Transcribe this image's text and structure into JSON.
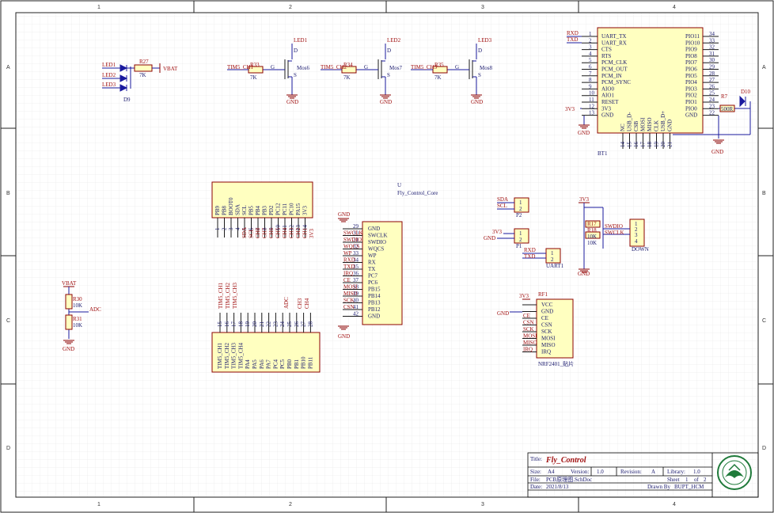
{
  "zones": {
    "cols": [
      "1",
      "2",
      "3",
      "4"
    ],
    "rows": [
      "A",
      "B",
      "C",
      "D"
    ]
  },
  "title_block": {
    "title_label": "Title:",
    "title": "Fly_Control",
    "size_label": "Size:",
    "size": "A4",
    "version_label": "Version:",
    "version": "1.0",
    "revision_label": "Revision:",
    "revision": "A",
    "library_label": "Library:",
    "library": "1.0",
    "file_label": "File:",
    "file": "PCB原理图.SchDoc",
    "sheet_label": "Sheet",
    "sheet": "1",
    "sheet_of": "of",
    "sheet_total": "2",
    "date_label": "Date:",
    "date": "2021/8/13",
    "drawn_label": "Drawn By",
    "drawn_by": "BUPT_HCM"
  },
  "leds_group": {
    "net_led1": "LED1",
    "net_led2": "LED2",
    "net_led3": "LED3",
    "r_ref": "R27",
    "r_val": "7K",
    "power": "VBAT",
    "diode_ref": "D9"
  },
  "mosfets": [
    {
      "led": "LED1",
      "ref": "Mos6",
      "r_ref": "R33",
      "r_val": "7K",
      "tim": "TIM5_CH1",
      "gnd": "GND",
      "g": "G",
      "d": "D",
      "s": "S"
    },
    {
      "led": "LED2",
      "ref": "Mos7",
      "r_ref": "R34",
      "r_val": "7K",
      "tim": "TIM5_CH2",
      "gnd": "GND",
      "g": "G",
      "d": "D",
      "s": "S"
    },
    {
      "led": "LED3",
      "ref": "Mos8",
      "r_ref": "R35",
      "r_val": "7K",
      "tim": "TIM5_CH3",
      "gnd": "GND",
      "g": "G",
      "d": "D",
      "s": "S"
    }
  ],
  "bt": {
    "ref": "BT1",
    "net_rxd": "RXD",
    "net_txd": "TXD",
    "net_3v3": "3V3",
    "gnd": "GND",
    "left_pins": [
      {
        "n": "1",
        "name": "UART_TX"
      },
      {
        "n": "2",
        "name": "UART_RX"
      },
      {
        "n": "3",
        "name": "CTS"
      },
      {
        "n": "4",
        "name": "RTS"
      },
      {
        "n": "5",
        "name": "PCM_CLK"
      },
      {
        "n": "6",
        "name": "PCM_OUT"
      },
      {
        "n": "7",
        "name": "PCM_IN"
      },
      {
        "n": "8",
        "name": "PCM_SYNC"
      },
      {
        "n": "9",
        "name": "AIO0"
      },
      {
        "n": "10",
        "name": "AIO1"
      },
      {
        "n": "11",
        "name": "RESET"
      },
      {
        "n": "12",
        "name": "3V3"
      },
      {
        "n": "13",
        "name": "GND"
      }
    ],
    "right_pins": [
      {
        "n": "34",
        "name": "PIO11"
      },
      {
        "n": "33",
        "name": "PIO10"
      },
      {
        "n": "32",
        "name": "PIO9"
      },
      {
        "n": "31",
        "name": "PIO8"
      },
      {
        "n": "30",
        "name": "PIO7"
      },
      {
        "n": "29",
        "name": "PIO6"
      },
      {
        "n": "28",
        "name": "PIO5"
      },
      {
        "n": "27",
        "name": "PIO4"
      },
      {
        "n": "26",
        "name": "PIO3"
      },
      {
        "n": "25",
        "name": "PIO2"
      },
      {
        "n": "24",
        "name": "PIO1"
      },
      {
        "n": "23",
        "name": "PIO0"
      },
      {
        "n": "22",
        "name": "GND"
      }
    ],
    "bottom_pins": [
      {
        "n": "14",
        "name": "NC"
      },
      {
        "n": "15",
        "name": "USB_D-"
      },
      {
        "n": "16",
        "name": "CSB"
      },
      {
        "n": "17",
        "name": "MOSI"
      },
      {
        "n": "18",
        "name": "MISO"
      },
      {
        "n": "19",
        "name": "CLK"
      },
      {
        "n": "20",
        "name": "USB_D+"
      },
      {
        "n": "21",
        "name": "GND"
      }
    ],
    "r_ref": "R7",
    "r_val": "500R",
    "led_ref": "D10"
  },
  "core": {
    "ref": "U",
    "name": "Fly_Control_Core",
    "top_pins": [
      "PB9",
      "PB8",
      "BOOT0",
      "SDA",
      "SCL",
      "PB5",
      "PB4",
      "PB3",
      "PD2",
      "PC12",
      "PC11",
      "PC10",
      "PA15",
      "3V3"
    ],
    "top_nums": [
      "1",
      "2",
      "3",
      "4",
      "5",
      "6",
      "7",
      "8",
      "9",
      "10",
      "11",
      "12",
      "13",
      "14"
    ],
    "top_nets": [
      "SDA",
      "SCL",
      "CH8",
      "CH7",
      "CH6",
      "CH5",
      "CH4",
      "CH3",
      "CH2",
      "CH1",
      "3V3"
    ],
    "bottom_pins": [
      "TIM5_CH1",
      "TIM5_CH2",
      "TIM5_CH3",
      "TIM5_CH4",
      "PA4",
      "PA5",
      "PA6",
      "PA7",
      "PC4",
      "PC5",
      "PB0",
      "PB1",
      "PB10",
      "PB11"
    ],
    "bottom_nums": [
      "15",
      "16",
      "17",
      "18",
      "19",
      "20",
      "21",
      "22",
      "23",
      "24",
      "25",
      "26",
      "27",
      "28"
    ],
    "bottom_nets": [
      "TIM5_CH1",
      "TIM5_CH2",
      "TIM5_CH3",
      "ADC",
      "CH3",
      "CH4"
    ],
    "right_pins": [
      "GND",
      "SWCLK",
      "SWDIO",
      "WQCS",
      "WP",
      "RX",
      "TX",
      "PC7",
      "PC6",
      "PB15",
      "PB14",
      "PB13",
      "PB12",
      "GND"
    ],
    "right_nums": [
      "29",
      "30",
      "31",
      "32",
      "33",
      "34",
      "35",
      "36",
      "37",
      "38",
      "39",
      "40",
      "41",
      "42"
    ],
    "right_nets": [
      "SWCLK",
      "SWDIO",
      "WQCS",
      "WP",
      "RXD",
      "TXD",
      "IRQ",
      "CE",
      "MOSI",
      "MISO",
      "SCK",
      "CSN"
    ],
    "gnd": "GND"
  },
  "adc": {
    "power": "VBAT",
    "r30_ref": "R30",
    "r30_val": "10K",
    "r31_ref": "R31",
    "r31_val": "10K",
    "net": "ADC",
    "gnd": "GND"
  },
  "headers": {
    "p2": {
      "ref": "P2",
      "nets": [
        "SDA",
        "SCL"
      ],
      "pins": [
        "1",
        "2"
      ]
    },
    "p1": {
      "ref": "P1",
      "nets": [
        "3V3",
        "GND"
      ],
      "pins": [
        "1",
        "2"
      ]
    },
    "uart": {
      "ref": "UART1",
      "nets": [
        "RXD",
        "TXD"
      ],
      "pins": [
        "1",
        "2"
      ]
    },
    "down": {
      "ref": "DOWN",
      "power": "3V3",
      "r17_ref": "R17",
      "r17_val": "10K",
      "r18_ref": "R18",
      "r18_val": "10K",
      "nets": [
        "SWDIO",
        "SWCLK"
      ],
      "pins": [
        "1",
        "2",
        "3",
        "4"
      ],
      "gnd": "GND"
    }
  },
  "rf": {
    "ref": "RF1",
    "name": "NRF2401_贴片",
    "power": "3V3",
    "gnd": "GND",
    "pins": [
      "VCC",
      "GND",
      "CE",
      "CSN",
      "SCK",
      "MOSI",
      "MISO",
      "IRQ"
    ],
    "nets": [
      "CE",
      "CSN",
      "SCK",
      "MOSI",
      "MISO",
      "IRQ"
    ]
  }
}
